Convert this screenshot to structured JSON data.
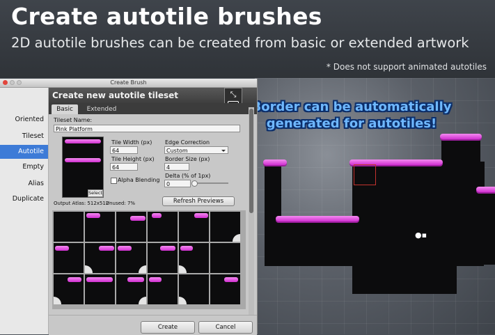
{
  "banner": {
    "title": "Create autotile brushes",
    "subtitle": "2D autotile brushes can be created from basic or extended artwork",
    "note": "* Does not support animated autotiles"
  },
  "callout": {
    "text": "Border can be automatically generated for autotiles!",
    "color": "#6fb8ff"
  },
  "window": {
    "title": "Create Brush",
    "sidebar": {
      "items": [
        {
          "label": "Oriented",
          "active": false
        },
        {
          "label": "Tileset",
          "active": false
        },
        {
          "label": "Autotile",
          "active": true
        },
        {
          "label": "Empty",
          "active": false
        },
        {
          "label": "Alias",
          "active": false
        },
        {
          "label": "Duplicate",
          "active": false
        }
      ]
    },
    "header": {
      "title": "Create new autotile tileset"
    },
    "tabs": [
      {
        "label": "Basic"
      },
      {
        "label": "Extended"
      }
    ],
    "form": {
      "tileset_name_label": "Tileset Name:",
      "tileset_name_value": "Pink Platform",
      "tile_width_label": "Tile Width (px)",
      "tile_width_value": "64",
      "tile_height_label": "Tile Height (px)",
      "tile_height_value": "64",
      "edge_correction_label": "Edge Correction",
      "edge_correction_value": "Custom",
      "border_size_label": "Border Size (px)",
      "border_size_value": "4",
      "delta_label": "Delta (% of 1px)",
      "delta_value": "0",
      "alpha_blending_label": "Alpha Blending",
      "select_label": "Select",
      "output_atlas": "Output Atlas: 512x512",
      "unused": "Unused: 7%",
      "refresh_label": "Refresh Previews"
    },
    "footer": {
      "create_label": "Create",
      "cancel_label": "Cancel"
    }
  },
  "colors": {
    "accent": "#3d7bd7",
    "grass": "#e060e0",
    "terrain": "#0c0c0d"
  }
}
